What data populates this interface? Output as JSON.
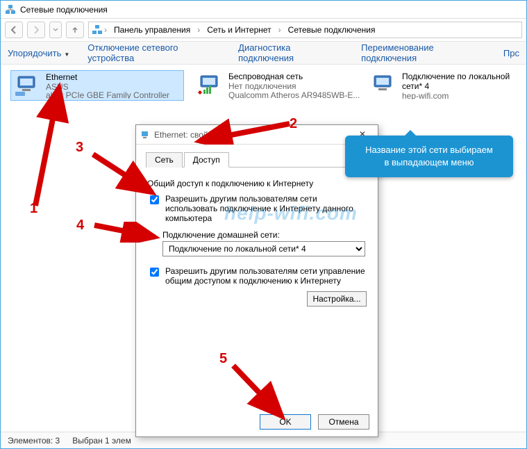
{
  "window": {
    "title": "Сетевые подключения"
  },
  "breadcrumbs": {
    "b1": "Панель управления",
    "b2": "Сеть и Интернет",
    "b3": "Сетевые подключения"
  },
  "toolbar": {
    "organize": "Упорядочить",
    "disable": "Отключение сетевого устройства",
    "diag": "Диагностика подключения",
    "rename": "Переименование подключения",
    "more": "Прс"
  },
  "nets": {
    "ethernet": {
      "name": "Ethernet",
      "sub": "ASUS",
      "det": "altek PCIe GBE Family Controller"
    },
    "wifi": {
      "name": "Беспроводная сеть",
      "sub": "Нет подключения",
      "det": "Qualcomm Atheros AR9485WB-E..."
    },
    "lan4": {
      "name": "Подключение по локальной сети* 4",
      "sub": "hеp-wifi.com",
      "det": ""
    }
  },
  "dialog": {
    "title": "Ethernet: свойства",
    "tab_net": "Сеть",
    "tab_access": "Доступ",
    "section": "Общий доступ к подключению к Интернету",
    "chk1": "Разрешить другим пользователям сети использовать подключение к Интернету данного компьютера",
    "select_label": "Подключение домашней сети:",
    "select_value": "Подключение по локальной сети* 4",
    "chk2": "Разрешить другим пользователям сети управление общим доступом к подключению к Интернету",
    "configure": "Настройка...",
    "ok": "OK",
    "cancel": "Отмена"
  },
  "status": {
    "elements": "Элементов: 3",
    "selected": "Выбран 1 элем"
  },
  "callout": {
    "line1": "Название этой сети выбираем",
    "line2": "в выпадающем меню"
  },
  "annotations": {
    "n1": "1",
    "n2": "2",
    "n3": "3",
    "n4": "4",
    "n5": "5"
  },
  "watermark": "help-wifi.com"
}
